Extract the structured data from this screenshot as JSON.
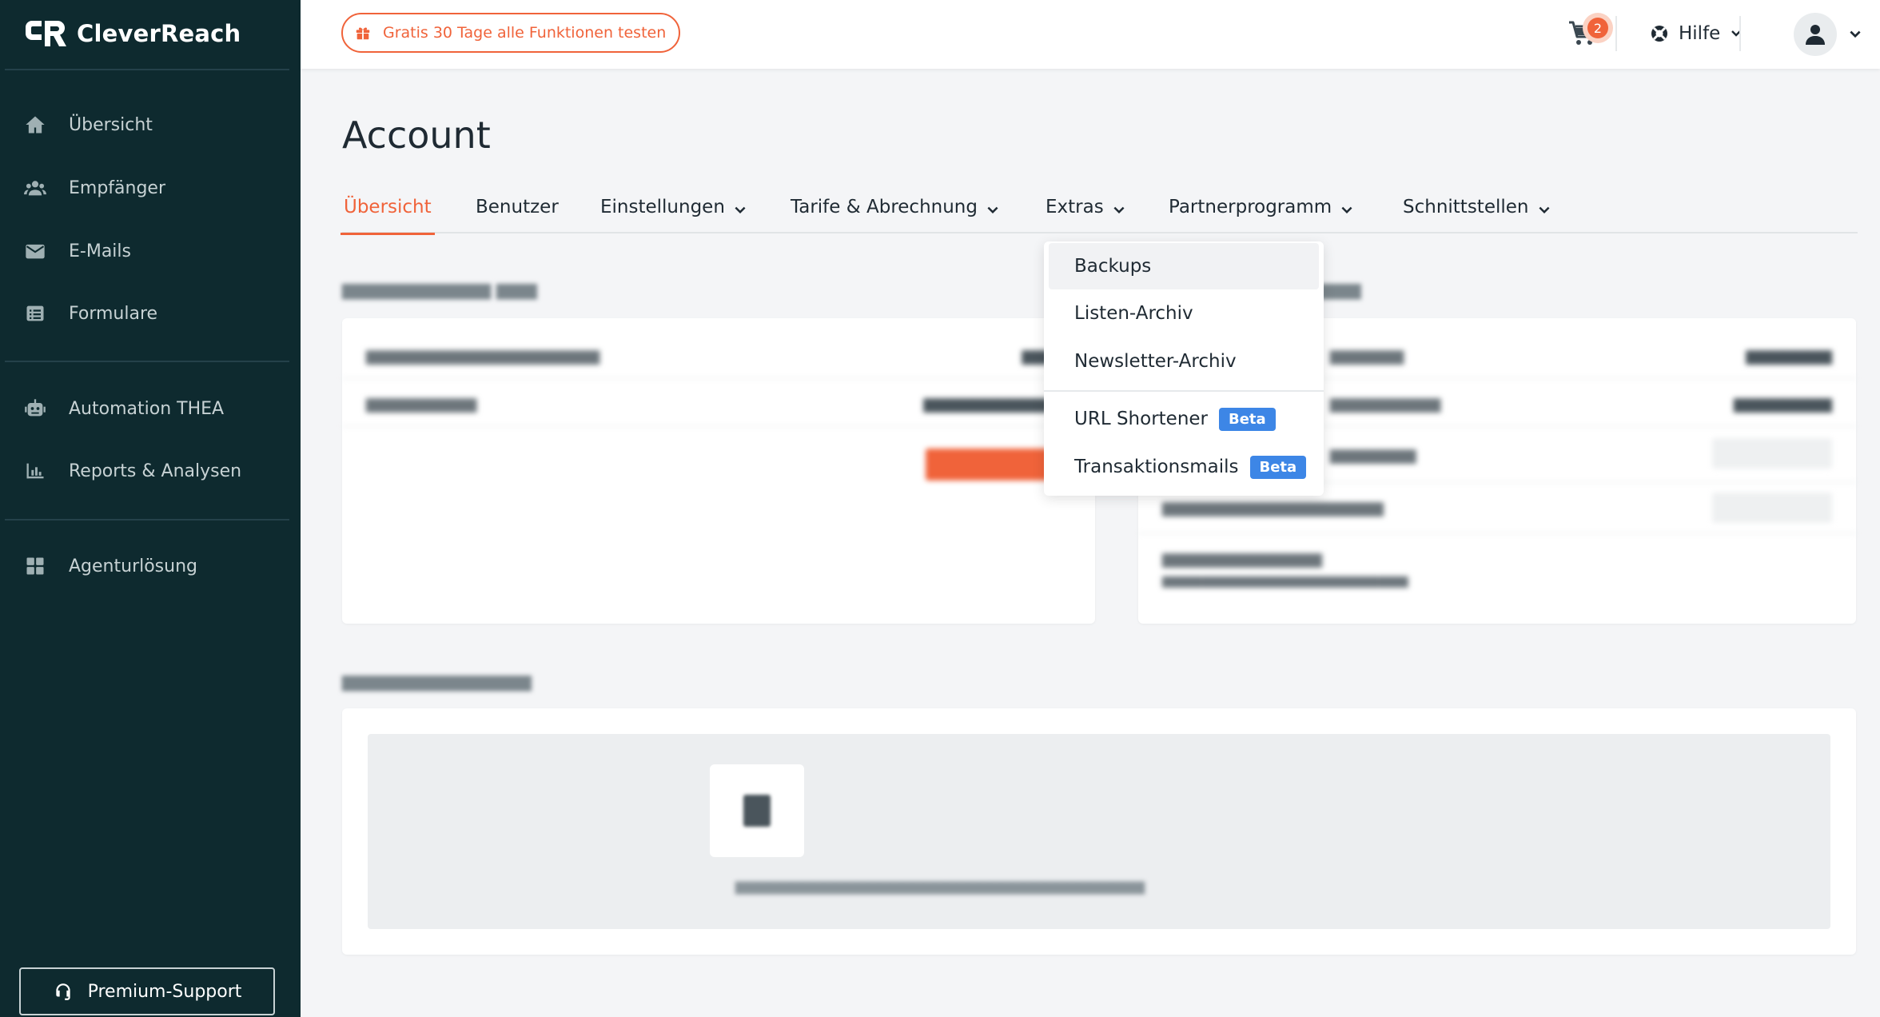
{
  "brand": {
    "name": "CleverReach"
  },
  "sidebar": {
    "items": [
      {
        "label": "Übersicht",
        "icon": "home-icon"
      },
      {
        "label": "Empfänger",
        "icon": "users-icon"
      },
      {
        "label": "E-Mails",
        "icon": "envelope-icon"
      },
      {
        "label": "Formulare",
        "icon": "form-icon"
      },
      {
        "label": "Automation THEA",
        "icon": "robot-icon"
      },
      {
        "label": "Reports & Analysen",
        "icon": "bar-chart-icon"
      },
      {
        "label": "Agenturlösung",
        "icon": "grid-icon"
      }
    ],
    "premium_support": "Premium-Support"
  },
  "topbar": {
    "trial_label": "Gratis 30 Tage alle Funktionen testen",
    "cart_count": "2",
    "help_label": "Hilfe"
  },
  "page": {
    "title": "Account",
    "tabs": [
      {
        "label": "Übersicht",
        "active": true
      },
      {
        "label": "Benutzer"
      },
      {
        "label": "Einstellungen"
      },
      {
        "label": "Tarife & Abrechnung"
      },
      {
        "label": "Extras"
      },
      {
        "label": "Partnerprogramm"
      },
      {
        "label": "Schnittstellen"
      }
    ]
  },
  "extras_menu": {
    "items": [
      {
        "label": "Backups"
      },
      {
        "label": "Listen-Archiv"
      },
      {
        "label": "Newsletter-Archiv"
      },
      {
        "label": "URL Shortener",
        "badge": "Beta"
      },
      {
        "label": "Transaktionsmails",
        "badge": "Beta"
      }
    ]
  },
  "colors": {
    "sidebar_bg": "#0e2a2f",
    "accent": "#f0633a",
    "beta_badge": "#3d86e6",
    "page_bg": "#f4f5f7"
  }
}
